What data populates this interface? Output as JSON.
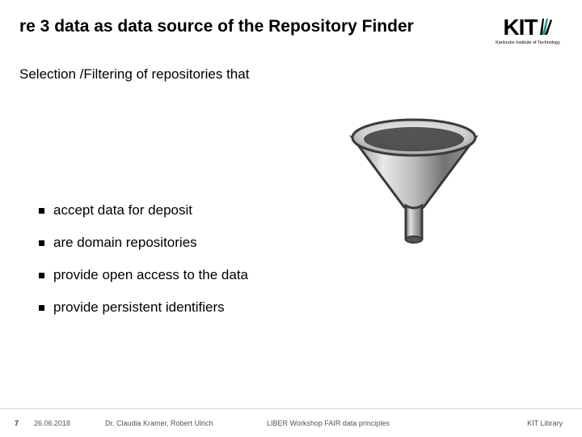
{
  "header": {
    "title": "re 3 data as data source of the Repository Finder",
    "logo_text": "KIT",
    "logo_tagline": "Karlsruhe Institute of Technology"
  },
  "subhead": "Selection /Filtering of repositories that",
  "bullets": [
    "accept data for deposit",
    "are domain repositories",
    "provide open access to the data",
    "provide persistent identifiers"
  ],
  "funnel": {
    "name": "funnel-icon"
  },
  "footer": {
    "page": "7",
    "date": "26.06.2018",
    "authors": "Dr. Claudia Kramer, Robert Ulrich",
    "event": "LIBER Workshop FAIR data principles",
    "org": "KIT Library"
  }
}
